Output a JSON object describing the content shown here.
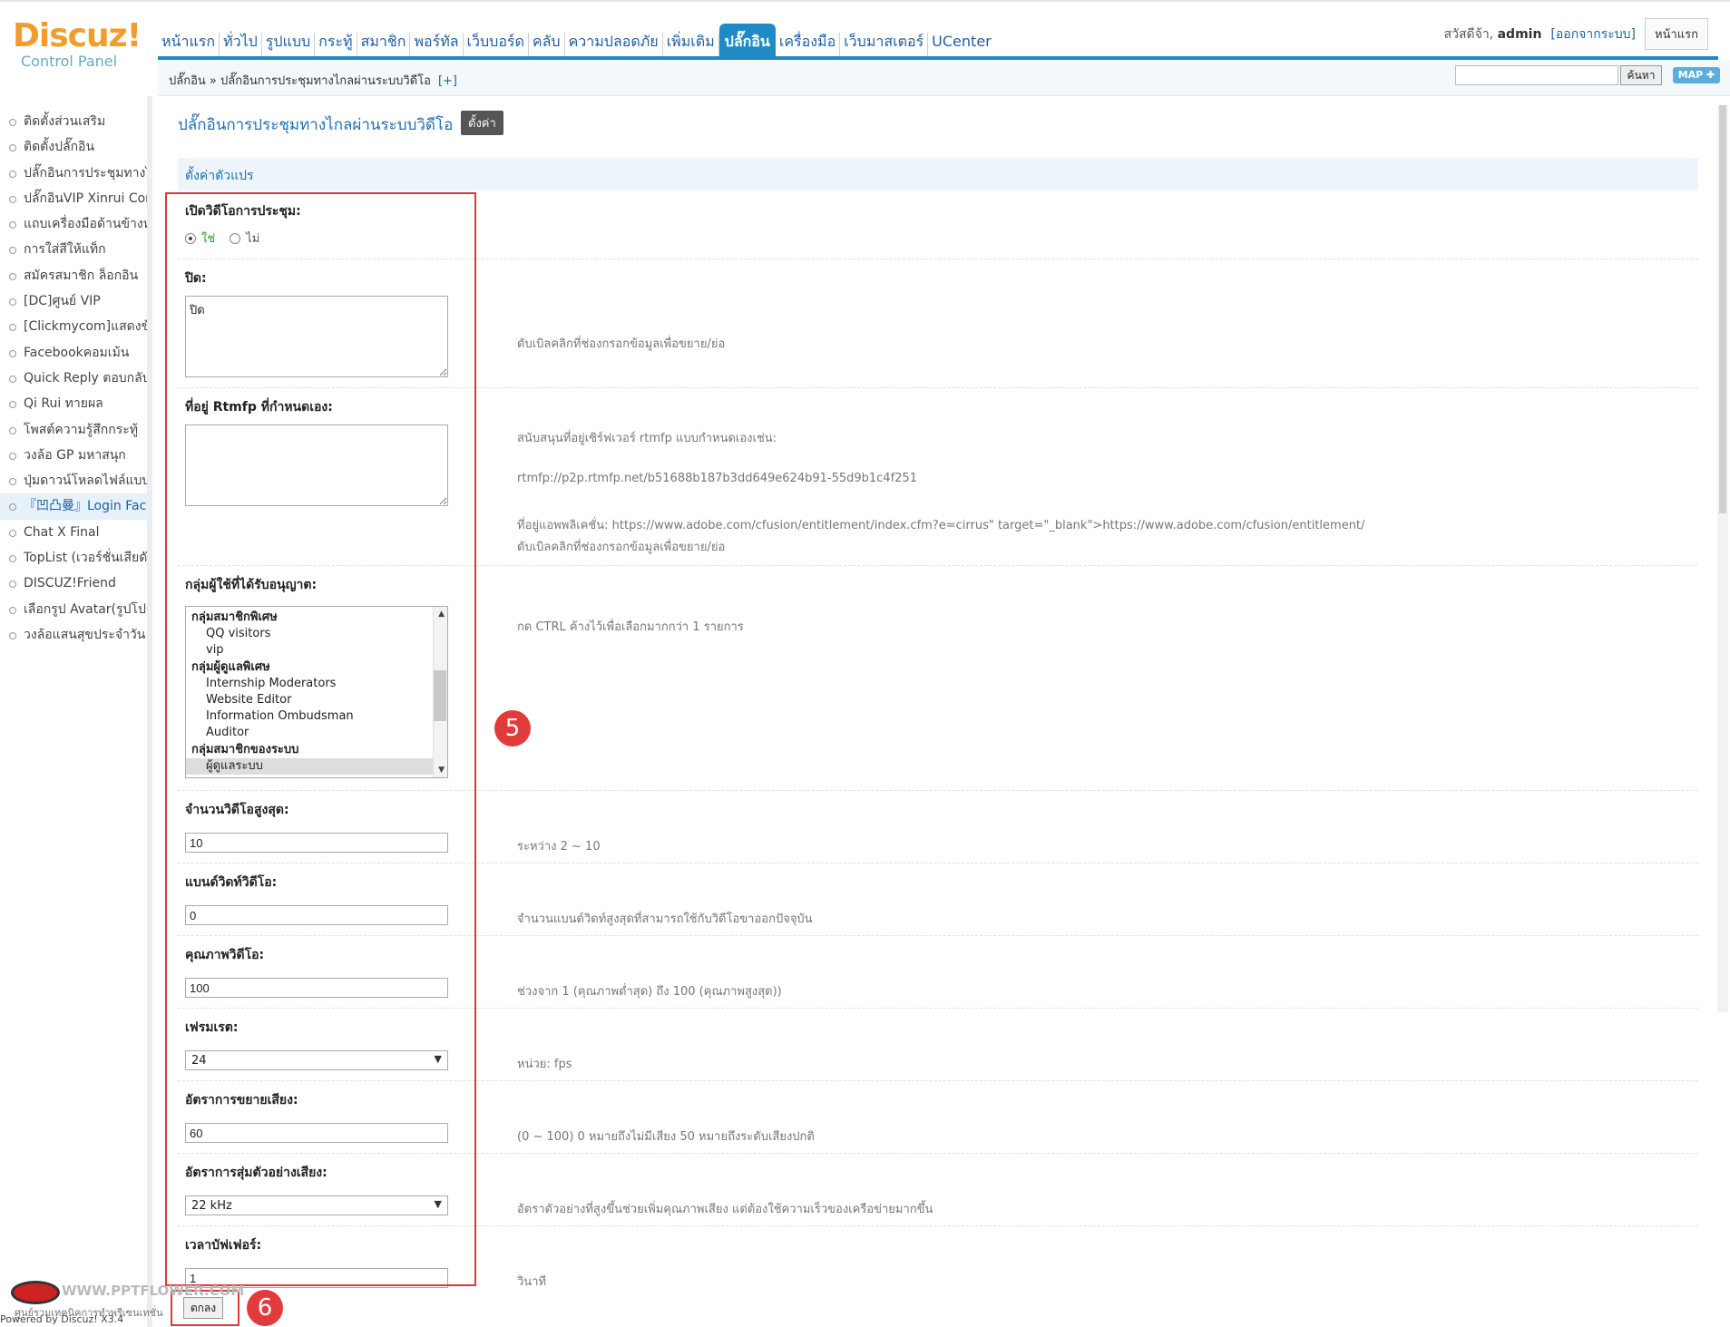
{
  "header": {
    "logo_main": "Discuz!",
    "logo_sub": "Control Panel",
    "nav": [
      "หน้าแรก",
      "ทั่วไป",
      "รูปแบบ",
      "กระทู้",
      "สมาชิก",
      "พอร์ทัล",
      "เว็บบอร์ด",
      "คลับ",
      "ความปลอดภัย",
      "เพิ่มเติม",
      "ปลั๊กอิน",
      "เครื่องมือ",
      "เว็บมาสเตอร์",
      "UCenter"
    ],
    "active_nav_index": 10,
    "greeting": "สวัสดีจ้า,",
    "username": "admin",
    "logout": "[ออกจากระบบ]",
    "home_button": "หน้าแรก"
  },
  "subbar": {
    "breadcrumb": "ปลั๊กอิน » ปลั๊กอินการประชุมทางไกลผ่านระบบวิดีโอ",
    "add_link": "[+]",
    "search_placeholder": "",
    "search_button": "ค้นหา",
    "map_button": "MAP ✚"
  },
  "sidebar": {
    "items": [
      "ติดตั้งส่วนเสริม",
      "ติดตั้งปลั๊กอิน",
      "ปลั๊กอินการประชุมทางไก",
      "ปลั๊กอินVIP Xinrui Con",
      "แถบเครื่องมือด้านข้างหล",
      "การใส่สีให้แท็ก",
      "สมัครสมาชิก ล็อกอิน",
      "[DC]ศูนย์ VIP",
      "[Clickmycom]แสดงข้อ",
      "Facebookคอมเม้น",
      "Quick Reply ตอบกลับเ",
      "Qi Rui ทายผล",
      "โพสต์ความรู้สึกกระทู้",
      "วงล้อ GP มหาสนุก",
      "ปุ่มดาวน์โหลดไฟล์แบบแ",
      "『凹凸曼』Login Face",
      "Chat X Final",
      "TopList (เวอร์ชั่นเสียดัง)",
      "DISCUZ!Friend",
      "เลือกรูป Avatar(รูปโปรไ",
      "วงล้อแสนสุขประจำวัน"
    ],
    "active_index": 15
  },
  "main": {
    "title": "ปลั๊กอินการประชุมทางไกลผ่านระบบวิดีโอ",
    "settings_tag": "ตั้งค่า",
    "section_title": "ตั้งค่าตัวแปร",
    "enable": {
      "label": "เปิดวิดีโอการประชุม:",
      "yes": "ใช่",
      "no": "ไม่"
    },
    "close": {
      "label": "ปิด:",
      "value": "ปิด",
      "hint": "ดับเบิลคลิกที่ช่องกรอกข้อมูลเพื่อขยาย/ย่อ"
    },
    "rtmfp": {
      "label": "ที่อยู่ Rtmfp ที่กำหนดเอง:",
      "value": "",
      "hint1": "สนับสนุนที่อยู่เซิร์ฟเวอร์ rtmfp แบบกำหนดเองเช่น:",
      "hint2": "rtmfp://p2p.rtmfp.net/b51688b187b3dd649e624b91-55d9b1c4f251",
      "hint3": "ที่อยู่แอพพลิเคชั่น: https://www.adobe.com/cfusion/entitlement/index.cfm?e=cirrus\" target=\"_blank\">https://www.adobe.com/cfusion/entitlement/",
      "hint4": "ดับเบิลคลิกที่ช่องกรอกข้อมูลเพื่อขยาย/ย่อ"
    },
    "groups": {
      "label": "กลุ่มผู้ใช้ที่ได้รับอนุญาต:",
      "hint": "กด CTRL ค้างไว้เพื่อเลือกมากกว่า 1 รายการ",
      "options": [
        {
          "text": "กลุ่มสมาชิกพิเศษ",
          "group": true
        },
        {
          "text": "QQ visitors",
          "group": false
        },
        {
          "text": "vip",
          "group": false
        },
        {
          "text": "กลุ่มผู้ดูแลพิเศษ",
          "group": true
        },
        {
          "text": "Internship Moderators",
          "group": false
        },
        {
          "text": "Website Editor",
          "group": false
        },
        {
          "text": "Information Ombudsman",
          "group": false
        },
        {
          "text": "Auditor",
          "group": false
        },
        {
          "text": "กลุ่มสมาชิกของระบบ",
          "group": true
        },
        {
          "text": "ผู้ดูแลระบบ",
          "group": false,
          "selected": true
        }
      ]
    },
    "max_videos": {
      "label": "จำนวนวิดีโอสูงสุด:",
      "value": "10",
      "hint": "ระหว่าง 2 ~ 10"
    },
    "bandwidth": {
      "label": "แบนด์วิดท์วิดีโอ:",
      "value": "0",
      "hint": "จำนวนแบนด์วิดท์สูงสุดที่สามารถใช้กับวิดีโอขาออกปัจจุบัน"
    },
    "quality": {
      "label": "คุณภาพวิดีโอ:",
      "value": "100",
      "hint": "ช่วงจาก 1 (คุณภาพต่ำสุด) ถึง 100 (คุณภาพสูงสุด))"
    },
    "framerate": {
      "label": "เฟรมเรต:",
      "value": "24",
      "hint": "หน่วย: fps"
    },
    "gain": {
      "label": "อัตราการขยายเสียง:",
      "value": "60",
      "hint": "(0 ~ 100) 0 หมายถึงไม่มีเสียง 50 หมายถึงระดับเสียงปกติ"
    },
    "samplerate": {
      "label": "อัตราการสุ่มตัวอย่างเสียง:",
      "value": "22 kHz",
      "hint": "อัตราตัวอย่างที่สูงขึ้นช่วยเพิ่มคุณภาพเสียง แต่ต้องใช้ความเร็วของเครือข่ายมากขึ้น"
    },
    "buffer": {
      "label": "เวลาบัฟเฟอร์:",
      "value": "1",
      "hint": "วินาที"
    },
    "submit": "ตกลง"
  },
  "annotations": {
    "badge5": "5",
    "badge6": "6",
    "color": "#e23b3b"
  },
  "footer": {
    "site": "WWW.PPTFLOWER.COM",
    "tagline": "ศูนย์รวมเทคนิคการทำพรีเซนเทชั่น",
    "powered": "Powered by Discuz! X3.4"
  }
}
